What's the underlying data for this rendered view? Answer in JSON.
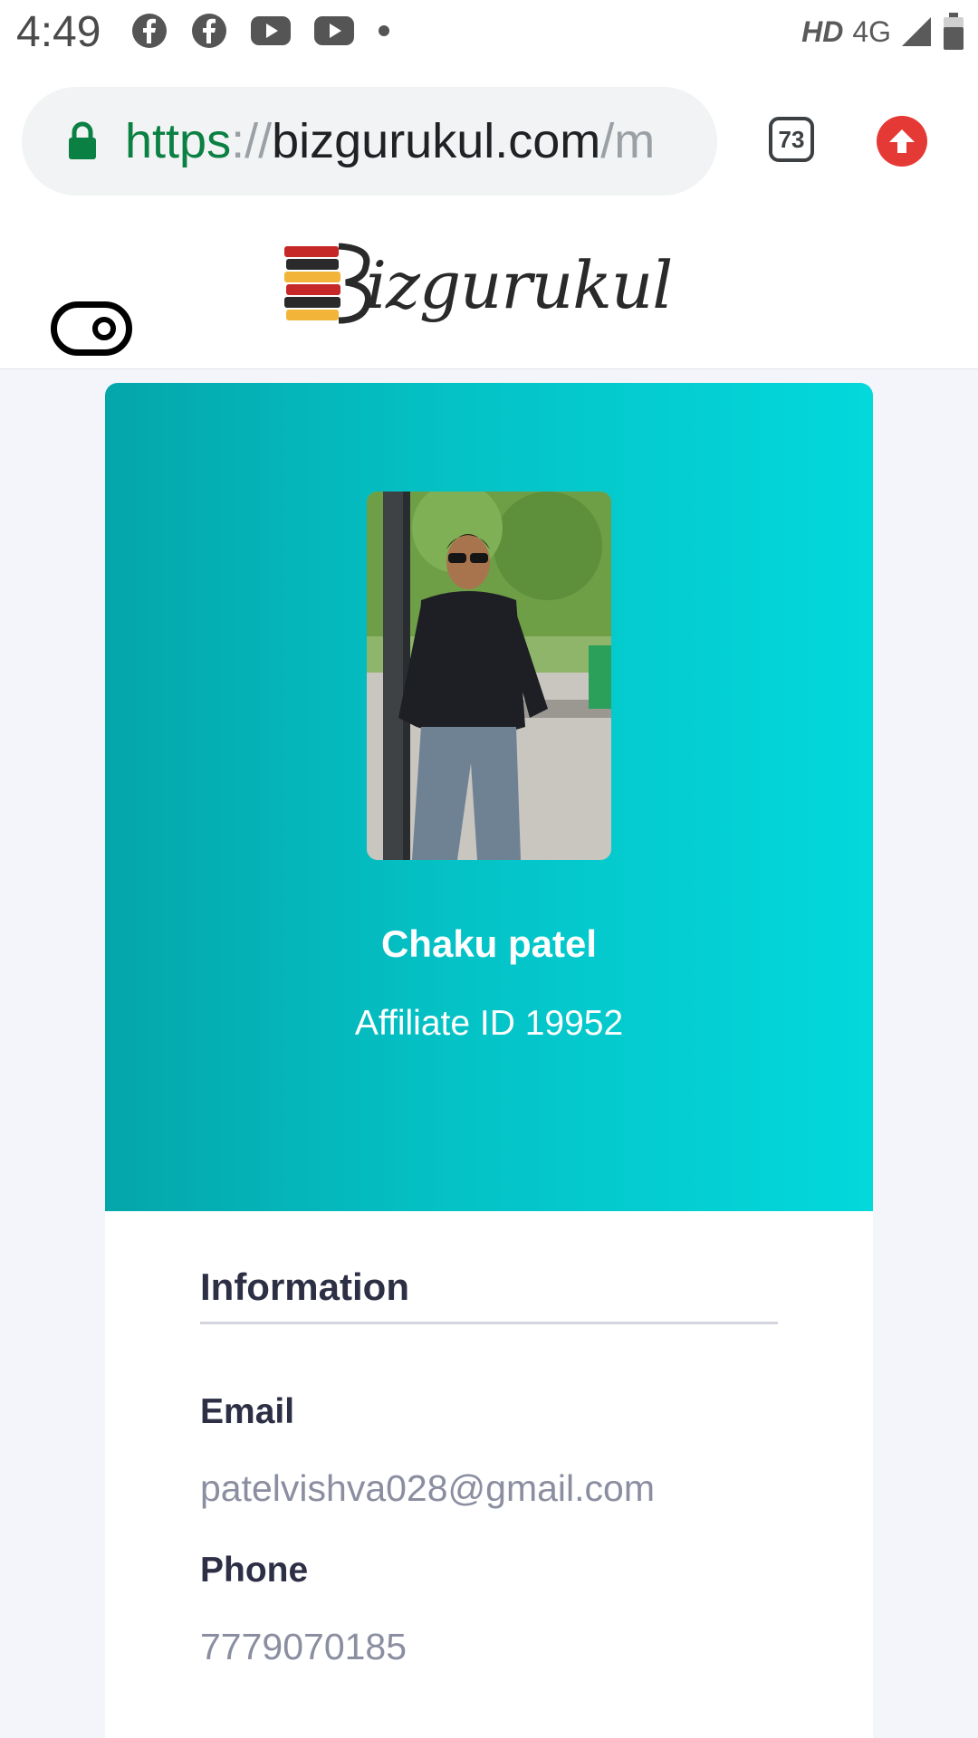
{
  "status_bar": {
    "time": "4:49",
    "icons": [
      "facebook-icon",
      "facebook-icon",
      "youtube-icon",
      "youtube-icon",
      "dot-icon"
    ],
    "network_hd": "HD",
    "network_type": "4G"
  },
  "browser": {
    "url_scheme": "https",
    "url_separator": "://",
    "url_host": "bizgurukul.com",
    "url_path": "/m",
    "tab_count": "73",
    "colors": {
      "secure": "#0b8043",
      "upload_button": "#e53935"
    }
  },
  "site": {
    "logo_initial": "B",
    "logo_text": "izgurukul"
  },
  "profile": {
    "name": "Chaku patel",
    "affiliate_id": "Affiliate ID 19952",
    "hero_colors": [
      "#04a6aa",
      "#03d8db"
    ]
  },
  "info": {
    "heading": "Information",
    "email_label": "Email",
    "email_value": "patelvishva028@gmail.com",
    "phone_label": "Phone",
    "phone_value": "7779070185"
  }
}
